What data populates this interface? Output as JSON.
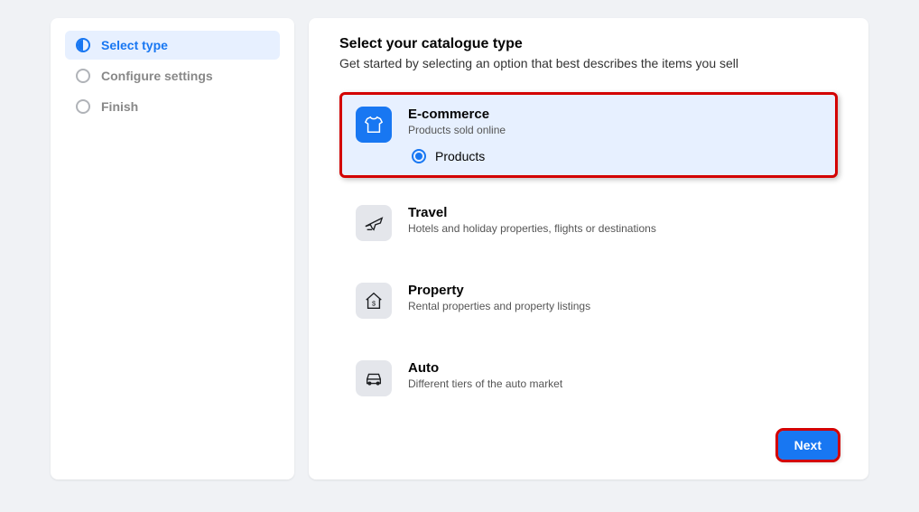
{
  "sidebar": {
    "steps": [
      {
        "label": "Select type",
        "active": true
      },
      {
        "label": "Configure settings",
        "active": false
      },
      {
        "label": "Finish",
        "active": false
      }
    ]
  },
  "main": {
    "title": "Select your catalogue type",
    "subtitle": "Get started by selecting an option that best describes the items you sell",
    "next_label": "Next",
    "options": [
      {
        "title": "E-commerce",
        "desc": "Products sold online",
        "selected": true,
        "radio_label": "Products",
        "icon": "tshirt-icon"
      },
      {
        "title": "Travel",
        "desc": "Hotels and holiday properties, flights or destinations",
        "selected": false,
        "icon": "plane-icon"
      },
      {
        "title": "Property",
        "desc": "Rental properties and property listings",
        "selected": false,
        "icon": "house-icon"
      },
      {
        "title": "Auto",
        "desc": "Different tiers of the auto market",
        "selected": false,
        "icon": "car-icon"
      }
    ]
  }
}
